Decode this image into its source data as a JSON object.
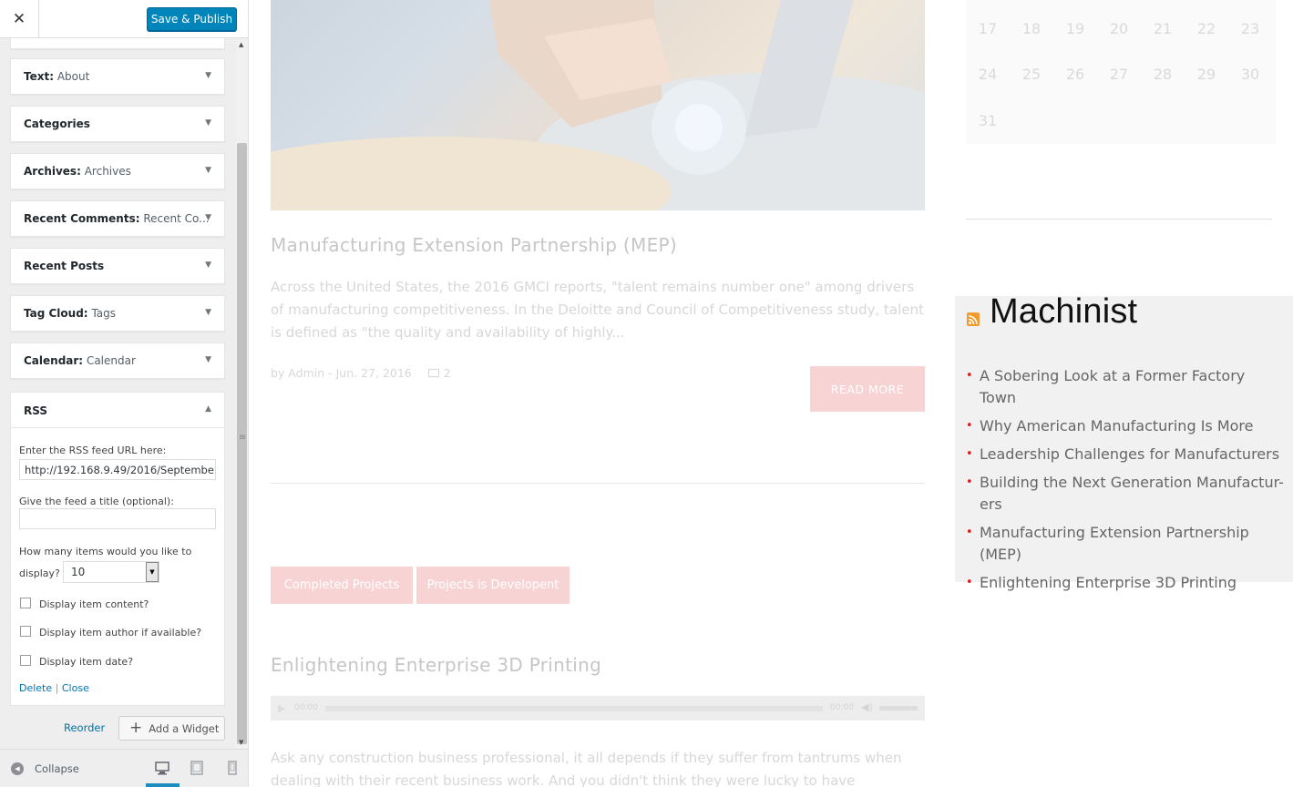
{
  "customizer": {
    "close_glyph": "✕",
    "publish_label": "Save & Publish",
    "widgets": [
      {
        "title": "Text:",
        "sub": "About"
      },
      {
        "title": "Categories",
        "sub": ""
      },
      {
        "title": "Archives:",
        "sub": "Archives"
      },
      {
        "title": "Recent Comments:",
        "sub": "Recent Co..."
      },
      {
        "title": "Recent Posts",
        "sub": ""
      },
      {
        "title": "Tag Cloud:",
        "sub": "Tags"
      },
      {
        "title": "Calendar:",
        "sub": "Calendar"
      }
    ],
    "rss": {
      "title": "RSS",
      "url_label": "Enter the RSS feed URL here:",
      "url_value": "http://192.168.9.49/2016/Septembe",
      "feed_title_label": "Give the feed a title (optional):",
      "feed_title_value": "",
      "items_label_1": "How many items would you like to",
      "items_label_2": "display?",
      "items_value": "10",
      "checkboxes": [
        {
          "label": "Display item content?",
          "checked": false
        },
        {
          "label": "Display item author if available?",
          "checked": false
        },
        {
          "label": "Display item date?",
          "checked": false
        }
      ],
      "delete_label": "Delete",
      "separator": "|",
      "close_label": "Close"
    },
    "reorder_label": "Reorder",
    "add_widget_label": "Add a Widget",
    "collapse_label": "Collapse",
    "devices": [
      "desktop-icon",
      "tablet-icon",
      "mobile-icon"
    ]
  },
  "preview": {
    "post1": {
      "title": "Manufacturing Extension Partnership (MEP)",
      "excerpt": "Across the United States, the 2016 GMCI reports, \"talent remains number one\" among drivers of manufacturing competitiveness. In the Deloitte and Council of Competitiveness study, talent is defined as \"the quality and availability of highly...",
      "meta_author": "by Admin - Jun. 27, 2016",
      "comments": "2",
      "read_more": "READ MORE"
    },
    "tags": [
      "Completed Projects",
      "Projects is Developent"
    ],
    "post2": {
      "title": "Enlightening Enterprise 3D Printing",
      "time_start": "00:00",
      "time_end": "00:00",
      "excerpt": "Ask any construction business professional, it all depends if they suffer from tantrums when dealing with their recent business work. And you didn't think they were lucky to have experienced it in..."
    },
    "calendar_rows": [
      [
        "17",
        "18",
        "19",
        "20",
        "21",
        "22",
        "23"
      ],
      [
        "24",
        "25",
        "26",
        "27",
        "28",
        "29",
        "30"
      ],
      [
        "31"
      ]
    ],
    "rss_widget": {
      "heading": "Machinist",
      "items": [
        "A Sobering Look at a Former Factory Town",
        "Why American Manufacturing Is More",
        "Leadership Challenges for Manufacturers",
        "Building the Next Generation Manufactur-ers",
        "Manufacturing Extension Partnership (MEP)",
        "Enlightening Enterprise 3D Printing"
      ]
    }
  },
  "colors": {
    "primary": "#0085ba",
    "link": "#0073aa",
    "accent_pink": "#f8d3d3",
    "bullet_red": "#d21f1f"
  }
}
